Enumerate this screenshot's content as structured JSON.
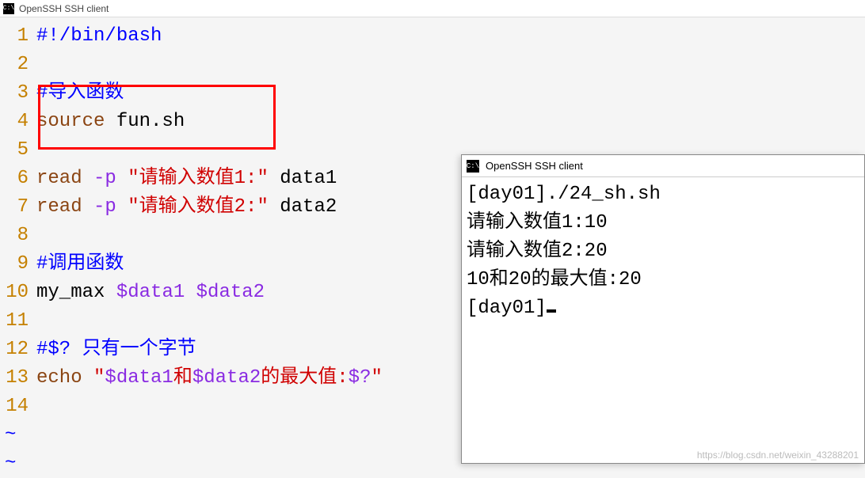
{
  "main_window": {
    "title": "OpenSSH SSH client",
    "icon_label": "C:\\"
  },
  "code_lines": [
    {
      "n": "1",
      "segments": [
        {
          "cls": "blue",
          "t": "#!/bin/bash"
        }
      ]
    },
    {
      "n": "2",
      "segments": []
    },
    {
      "n": "3",
      "segments": [
        {
          "cls": "blue",
          "t": "#导入函数"
        }
      ]
    },
    {
      "n": "4",
      "segments": [
        {
          "cls": "brown",
          "t": "source"
        },
        {
          "cls": "black",
          "t": " fun.sh"
        }
      ]
    },
    {
      "n": "5",
      "segments": []
    },
    {
      "n": "6",
      "segments": [
        {
          "cls": "brown",
          "t": "read"
        },
        {
          "cls": "purple",
          "t": " -p"
        },
        {
          "cls": "black",
          "t": " "
        },
        {
          "cls": "red",
          "t": "\"请输入数值1:\""
        },
        {
          "cls": "black",
          "t": " data1"
        }
      ]
    },
    {
      "n": "7",
      "segments": [
        {
          "cls": "brown",
          "t": "read"
        },
        {
          "cls": "purple",
          "t": " -p"
        },
        {
          "cls": "black",
          "t": " "
        },
        {
          "cls": "red",
          "t": "\"请输入数值2:\""
        },
        {
          "cls": "black",
          "t": " data2"
        }
      ]
    },
    {
      "n": "8",
      "segments": []
    },
    {
      "n": "9",
      "segments": [
        {
          "cls": "blue",
          "t": "#调用函数"
        }
      ]
    },
    {
      "n": "10",
      "segments": [
        {
          "cls": "black",
          "t": "my_max "
        },
        {
          "cls": "purple",
          "t": "$data1 $data2"
        }
      ]
    },
    {
      "n": "11",
      "segments": []
    },
    {
      "n": "12",
      "segments": [
        {
          "cls": "blue",
          "t": "#$? 只有一个字节"
        }
      ]
    },
    {
      "n": "13",
      "segments": [
        {
          "cls": "brown",
          "t": "echo"
        },
        {
          "cls": "black",
          "t": " "
        },
        {
          "cls": "red",
          "t": "\""
        },
        {
          "cls": "purple",
          "t": "$data1"
        },
        {
          "cls": "red",
          "t": "和"
        },
        {
          "cls": "purple",
          "t": "$data2"
        },
        {
          "cls": "red",
          "t": "的最大值:"
        },
        {
          "cls": "purple",
          "t": "$?"
        },
        {
          "cls": "red",
          "t": "\""
        }
      ]
    },
    {
      "n": "14",
      "segments": []
    }
  ],
  "terminal_window": {
    "title": "OpenSSH SSH client",
    "icon_label": "C:\\"
  },
  "terminal_lines": [
    "[day01]./24_sh.sh",
    "请输入数值1:10",
    "请输入数值2:20",
    "10和20的最大值:20",
    "[day01]"
  ],
  "watermark": "https://blog.csdn.net/weixin_43288201"
}
